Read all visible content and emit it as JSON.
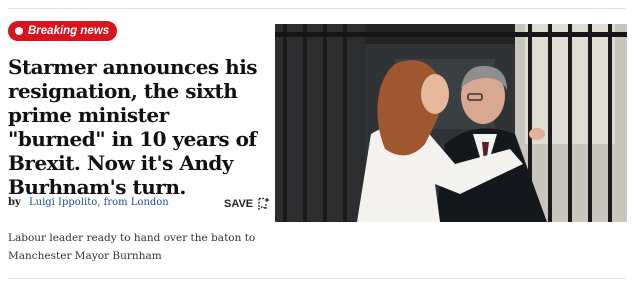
{
  "badge": {
    "label": "Breaking news"
  },
  "article": {
    "headline": "Starmer announces his resignation, the sixth prime minister \"burned\" in 10 years of Brexit. Now it's Andy Burhnam's turn.",
    "byline_prefix": "by",
    "author": "Luigi Ippolito, from London",
    "save_label": "SAVE",
    "summary": "Labour leader ready to hand over the baton to Manchester Mayor Burnham"
  },
  "icons": {
    "badge": "live-dot-icon",
    "save": "bookmark-add-icon"
  },
  "colors": {
    "badge_red": "#d5161e",
    "author_link": "#1a4d8f",
    "headline": "#111111"
  }
}
